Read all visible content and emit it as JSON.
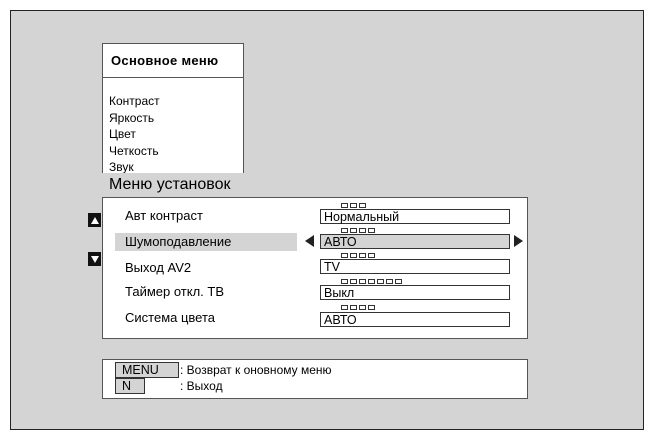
{
  "main_menu": {
    "title": "Основное меню",
    "items": [
      "Контраст",
      "Яркость",
      "Цвет",
      "Четкость",
      "Звук"
    ]
  },
  "setup_menu": {
    "title": "Меню установок",
    "rows": [
      {
        "label": "Авт контраст",
        "value": "Нормальный",
        "dots": 3
      },
      {
        "label": "Шумоподавление",
        "value": "АВТО",
        "dots": 4,
        "selected": true
      },
      {
        "label": "Выход AV2",
        "value": "TV",
        "dots": 4
      },
      {
        "label": "Таймер откл. ТВ",
        "value": "Выкл",
        "dots": 7
      },
      {
        "label": "Система цвета",
        "value": "АВТО",
        "dots": 4
      }
    ]
  },
  "help": {
    "menu_key": "MENU",
    "menu_text": ": Возврат к оновному меню",
    "n_key": "N",
    "n_text": ": Выход"
  },
  "colors": {
    "panel_gray": "#d4d4d4",
    "border": "#555555",
    "arrow": "#111111"
  }
}
